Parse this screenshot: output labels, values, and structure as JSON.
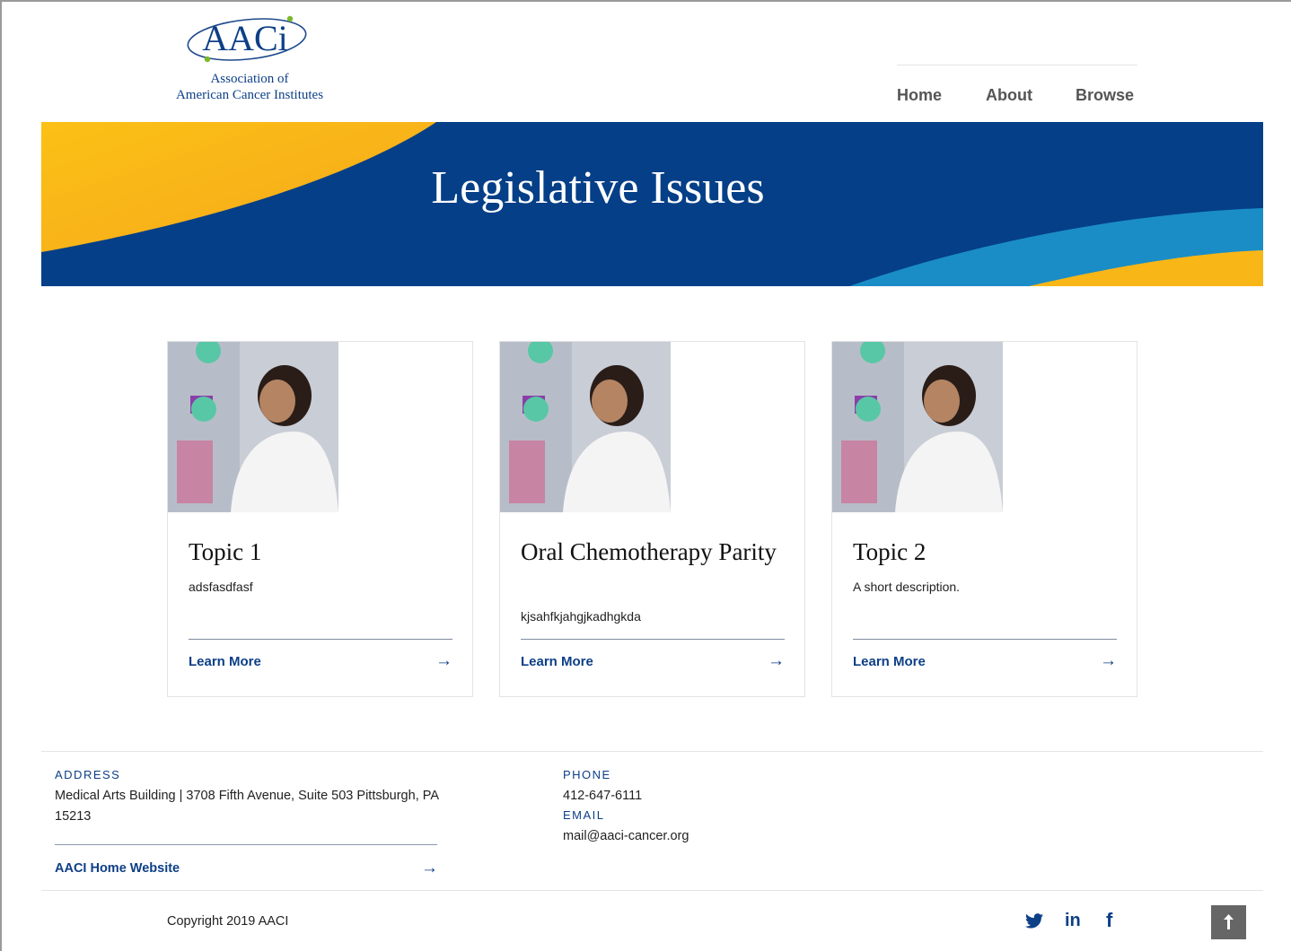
{
  "header": {
    "logo_text": "AACi",
    "logo_line1": "Association of",
    "logo_line2": "American Cancer Institutes",
    "nav": [
      {
        "label": "Home"
      },
      {
        "label": "About"
      },
      {
        "label": "Browse"
      }
    ]
  },
  "banner": {
    "title": "Legislative Issues"
  },
  "cards": [
    {
      "title": "Topic 1",
      "description": "adsfasdfasf",
      "link_label": "Learn More",
      "arrow": "→"
    },
    {
      "title": "Oral Chemotherapy Parity",
      "description": "kjsahfkjahgjkadhgkda",
      "link_label": "Learn More",
      "arrow": "→"
    },
    {
      "title": "Topic 2",
      "description": "A short description.",
      "link_label": "Learn More",
      "arrow": "→"
    }
  ],
  "footer": {
    "address_label": "ADDRESS",
    "address_value": "Medical Arts Building | 3708 Fifth Avenue, Suite 503 Pittsburgh, PA 15213",
    "phone_label": "PHONE",
    "phone_value": "412-647-6111",
    "email_label": "EMAIL",
    "email_value": "mail@aaci-cancer.org",
    "home_link": "AACI Home Website",
    "home_arrow": "→",
    "copyright": "Copyright 2019 AACI",
    "social_icons": [
      "twitter-icon",
      "linkedin-icon",
      "facebook-icon"
    ],
    "linkedin_text": "in",
    "facebook_text": "f"
  },
  "colors": {
    "brand_blue": "#043f87",
    "accent_yellow": "#f9b617",
    "accent_light_blue": "#1a8dc6",
    "link": "#0d3f87"
  }
}
